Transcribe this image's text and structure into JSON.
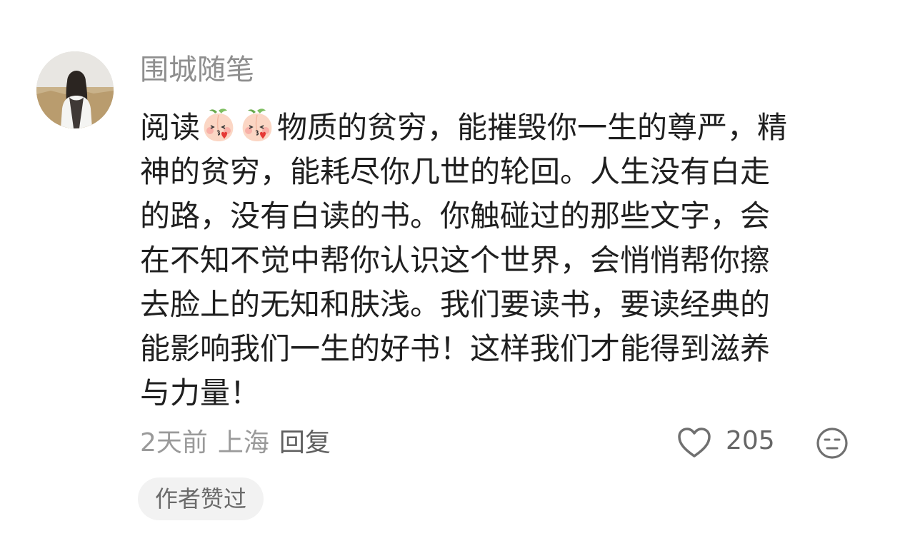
{
  "comment": {
    "username": "围城随笔",
    "avatar_icon": "avatar-photo-girl-in-field",
    "emoji_icon": "peach-blush-emoji",
    "lines": [
      {
        "before_emoji": "阅读",
        "after_emoji": "物质的贫穷，能摧毁你一生的尊严，精"
      },
      {
        "text": "神的贫穷，能耗尽你几世的轮回。人生没有白走"
      },
      {
        "text": "的路，没有白读的书。你触碰过的那些文字，会"
      },
      {
        "text": "在不知不觉中帮你认识这个世界，会悄悄帮你擦"
      },
      {
        "text": "去脸上的无知和肤浅。我们要读书，要读经典的"
      },
      {
        "text": "能影响我们一生的好书！这样我们才能得到滋养"
      },
      {
        "text": "与力量！"
      }
    ],
    "time": "2天前",
    "location": "上海",
    "reply_label": "回复",
    "like_icon": "heart-outline-icon",
    "like_count": "205",
    "dislike_icon": "neutral-face-icon",
    "author_badge": "作者赞过"
  }
}
